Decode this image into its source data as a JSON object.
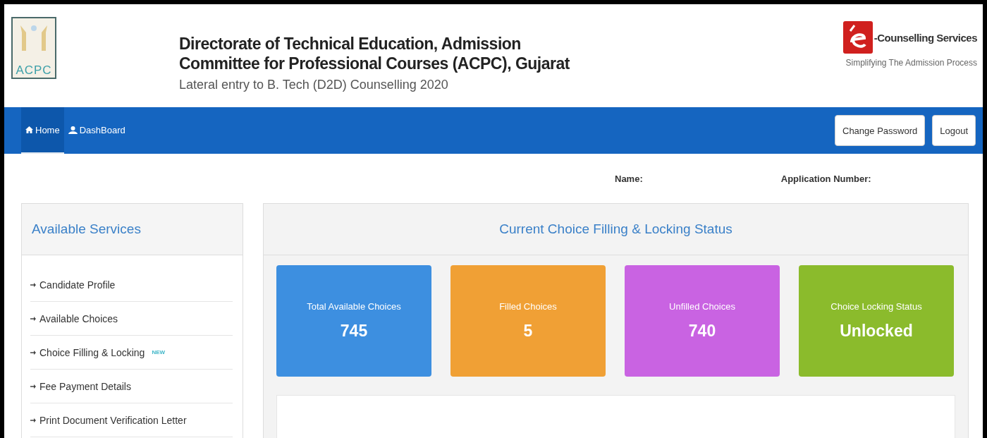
{
  "header": {
    "logo_text": "ACPC",
    "title_lines": [
      "Directorate of Technical Education, Admission",
      "Committee for Professional Courses (ACPC), Gujarat"
    ],
    "subtitle": "Lateral entry to B. Tech (D2D) Counselling 2020",
    "brand_name": "-Counselling Services",
    "brand_tagline": "Simplifying The Admission Process"
  },
  "nav": {
    "items": [
      {
        "label": "Home",
        "selected": true
      },
      {
        "label": "DashBoard",
        "selected": false
      }
    ],
    "buttons": [
      "Change Password",
      "Logout"
    ]
  },
  "user_info": {
    "name_label": "Name:",
    "application_label": "Application Number:"
  },
  "sidebar": {
    "title": "Available Services",
    "items": [
      {
        "label": "Candidate Profile"
      },
      {
        "label": "Available Choices"
      },
      {
        "label": "Choice Filling & Locking",
        "badge": "NEW"
      },
      {
        "label": "Fee Payment Details"
      },
      {
        "label": "Print Document Verification Letter"
      }
    ]
  },
  "status_panel": {
    "title": "Current Choice Filling & Locking Status",
    "cards": [
      {
        "label": "Total Available Choices",
        "value": "745",
        "color": "#3d8fe0"
      },
      {
        "label": "Filled Choices",
        "value": "5",
        "color": "#f0a035"
      },
      {
        "label": "Unfilled Choices",
        "value": "740",
        "color": "#c963e2"
      },
      {
        "label": "Choice Locking Status",
        "value": "Unlocked",
        "color": "#8bbb2c"
      }
    ]
  }
}
